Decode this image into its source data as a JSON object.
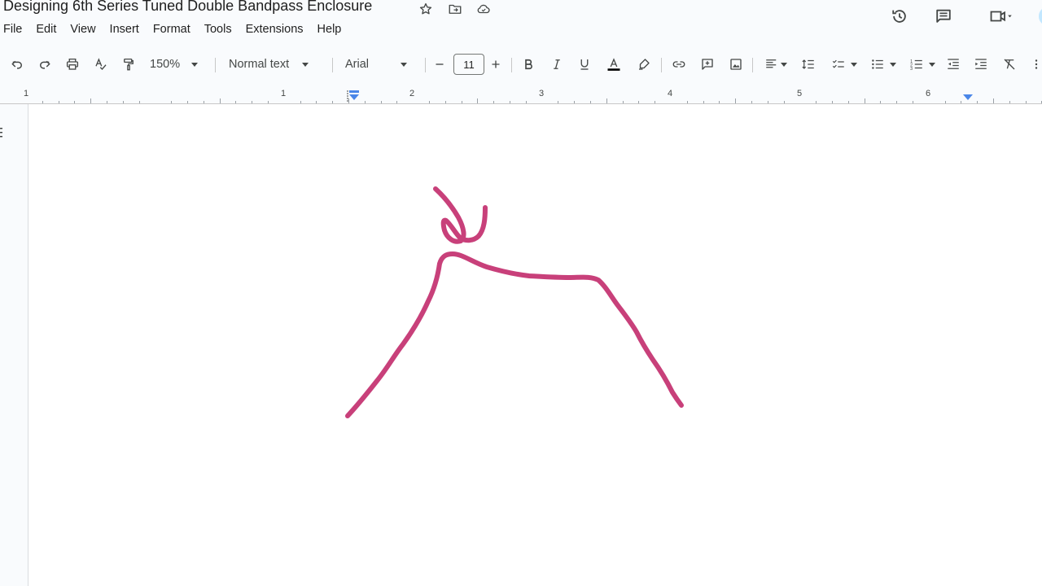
{
  "document": {
    "title": "Designing 6th Series Tuned Double Bandpass Enclosure"
  },
  "menu": {
    "items": [
      "File",
      "Edit",
      "View",
      "Insert",
      "Format",
      "Tools",
      "Extensions",
      "Help"
    ]
  },
  "toolbar": {
    "zoom": "150%",
    "style": "Normal text",
    "font": "Arial",
    "font_size": "11"
  },
  "ruler": {
    "numbers": [
      "1",
      "1",
      "2",
      "3",
      "4",
      "5",
      "6"
    ]
  },
  "icons": {
    "title_bar": [
      "star-icon",
      "move-to-folder-icon",
      "cloud-saved-icon"
    ],
    "header_right": [
      "version-history-icon",
      "comments-icon",
      "meet-camera-icon"
    ],
    "toolbar": [
      "undo-icon",
      "redo-icon",
      "print-icon",
      "spellcheck-icon",
      "paint-format-icon",
      "decrease-font-size-icon",
      "increase-font-size-icon",
      "bold-icon",
      "italic-icon",
      "underline-icon",
      "text-color-icon",
      "highlight-icon",
      "link-icon",
      "add-comment-icon",
      "insert-image-icon",
      "align-icon",
      "line-spacing-icon",
      "checklist-icon",
      "bulleted-list-icon",
      "numbered-list-icon",
      "decrease-indent-icon",
      "increase-indent-icon",
      "clear-formatting-icon",
      "more-icon"
    ]
  },
  "colors": {
    "ink": "#c8407a",
    "text_color_underline": "#000000",
    "accent_blue": "#4a86e8",
    "page_bg": "#ffffff",
    "canvas_bg": "#f9fbfd"
  }
}
